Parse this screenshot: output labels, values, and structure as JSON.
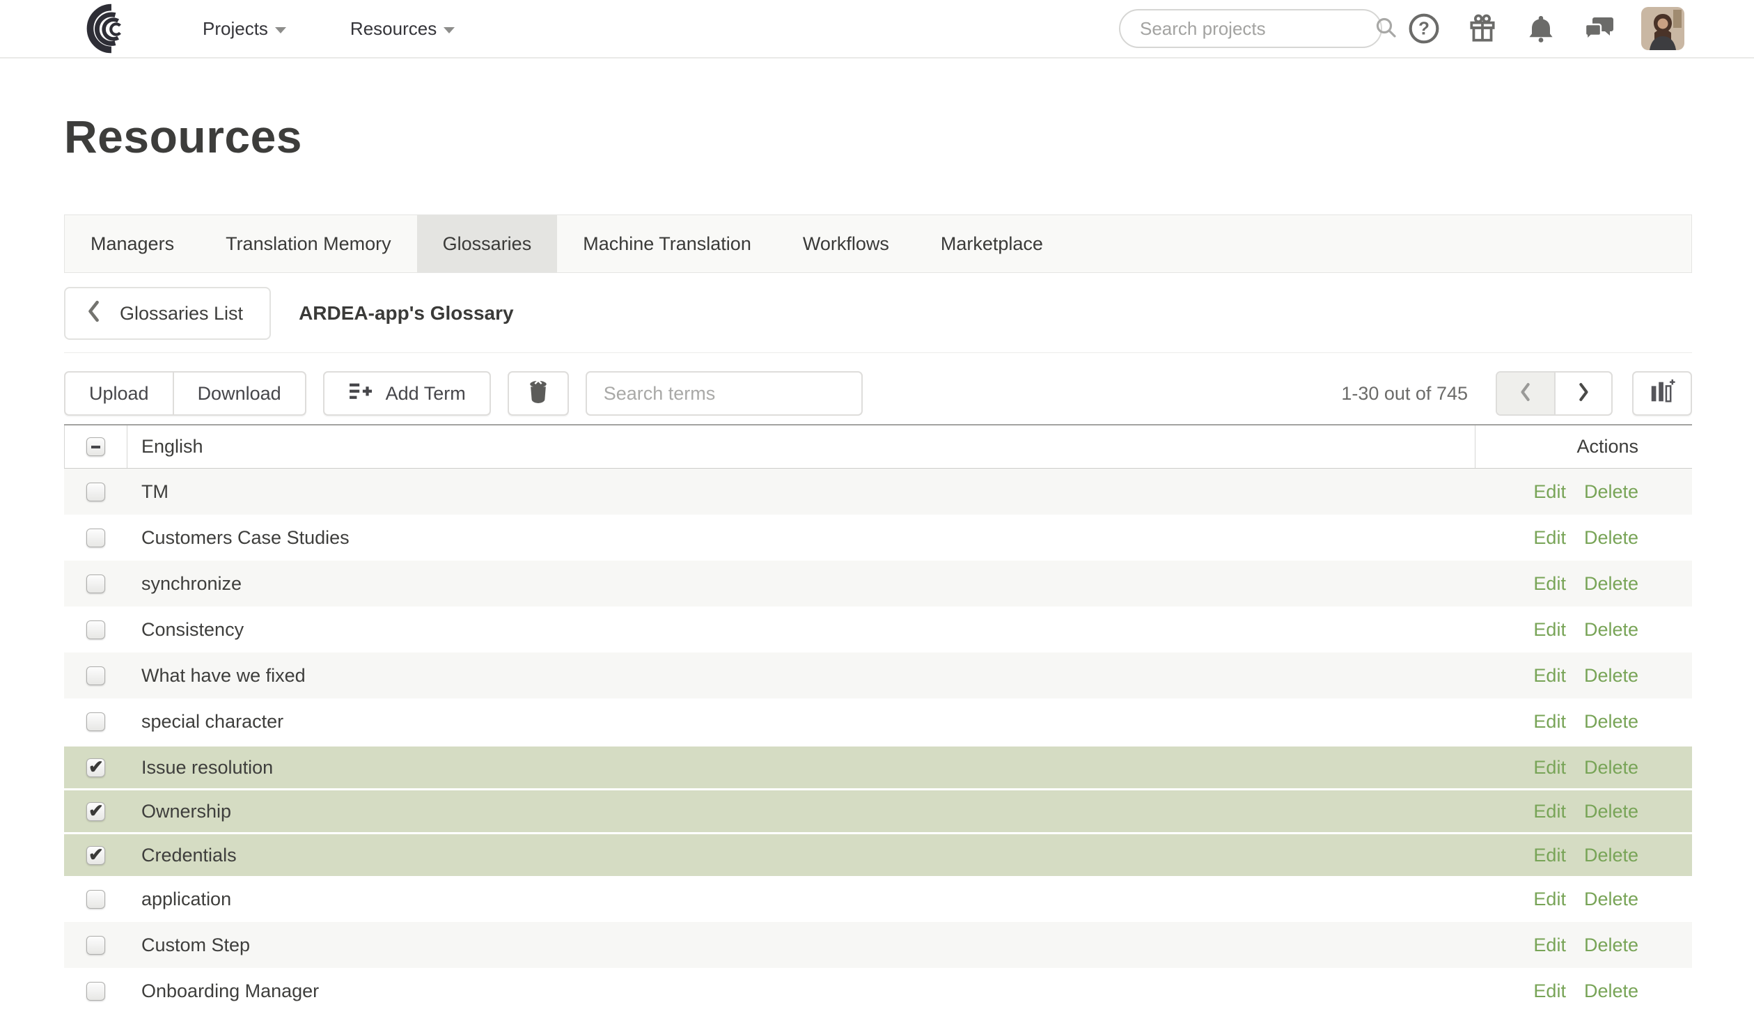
{
  "nav": {
    "logo_icon": "swirl-logo-icon",
    "menus": [
      {
        "label": "Projects"
      },
      {
        "label": "Resources"
      }
    ],
    "search_placeholder": "Search projects",
    "icons": [
      "search-icon",
      "help-icon",
      "gift-icon",
      "bell-icon",
      "chat-icon",
      "avatar"
    ]
  },
  "page": {
    "title": "Resources"
  },
  "tabs": {
    "items": [
      "Managers",
      "Translation Memory",
      "Glossaries",
      "Machine Translation",
      "Workflows",
      "Marketplace"
    ],
    "active": "Glossaries"
  },
  "breadcrumb": {
    "back_label": "Glossaries List",
    "current": "ARDEA-app's Glossary"
  },
  "toolbar": {
    "upload_label": "Upload",
    "download_label": "Download",
    "add_term_label": "Add Term",
    "trash_icon": "trash-icon",
    "search_placeholder": "Search terms",
    "range_label": "1-30 out of 745",
    "columns_icon": "columns-icon"
  },
  "table": {
    "header": {
      "language": "English",
      "actions": "Actions"
    },
    "row_actions": {
      "edit": "Edit",
      "delete": "Delete"
    },
    "rows": [
      {
        "term": "TM",
        "checked": false
      },
      {
        "term": "Customers Case Studies",
        "checked": false
      },
      {
        "term": "synchronize",
        "checked": false
      },
      {
        "term": "Consistency",
        "checked": false
      },
      {
        "term": "What have we fixed",
        "checked": false
      },
      {
        "term": "special character",
        "checked": false
      },
      {
        "term": "Issue resolution",
        "checked": true
      },
      {
        "term": "Ownership",
        "checked": true
      },
      {
        "term": "Credentials",
        "checked": true
      },
      {
        "term": "application",
        "checked": false
      },
      {
        "term": "Custom Step",
        "checked": false
      },
      {
        "term": "Onboarding Manager",
        "checked": false
      }
    ]
  },
  "colors": {
    "selected_row": "#d5dcc3",
    "action_link_green": "#78a457",
    "stripe_gray": "#f7f7f5",
    "active_tab_gray": "#e4e4e1",
    "text_dark": "#3e3e3c"
  }
}
